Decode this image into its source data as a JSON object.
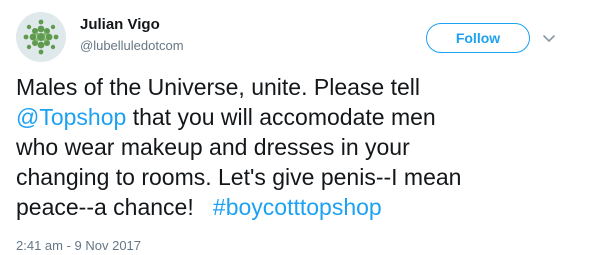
{
  "user": {
    "display_name": "Julian Vigo",
    "handle": "@lubelluledotcom"
  },
  "actions": {
    "follow_label": "Follow",
    "more_icon": "chevron-down-icon"
  },
  "tweet": {
    "line1": "Males of the Universe, unite.  Please tell",
    "mention": "@Topshop",
    "line2_rest": " that you will accomodate men",
    "line3": "who wear makeup and dresses in your",
    "line4": "changing to rooms. Let's give penis--I mean",
    "line5_text": "peace--a chance!   ",
    "hashtag": "#boycotttopshop"
  },
  "meta": {
    "timestamp": "2:41 am - 9 Nov 2017"
  },
  "colors": {
    "accent": "#1da1f2",
    "text": "#14171a",
    "muted": "#657786"
  }
}
